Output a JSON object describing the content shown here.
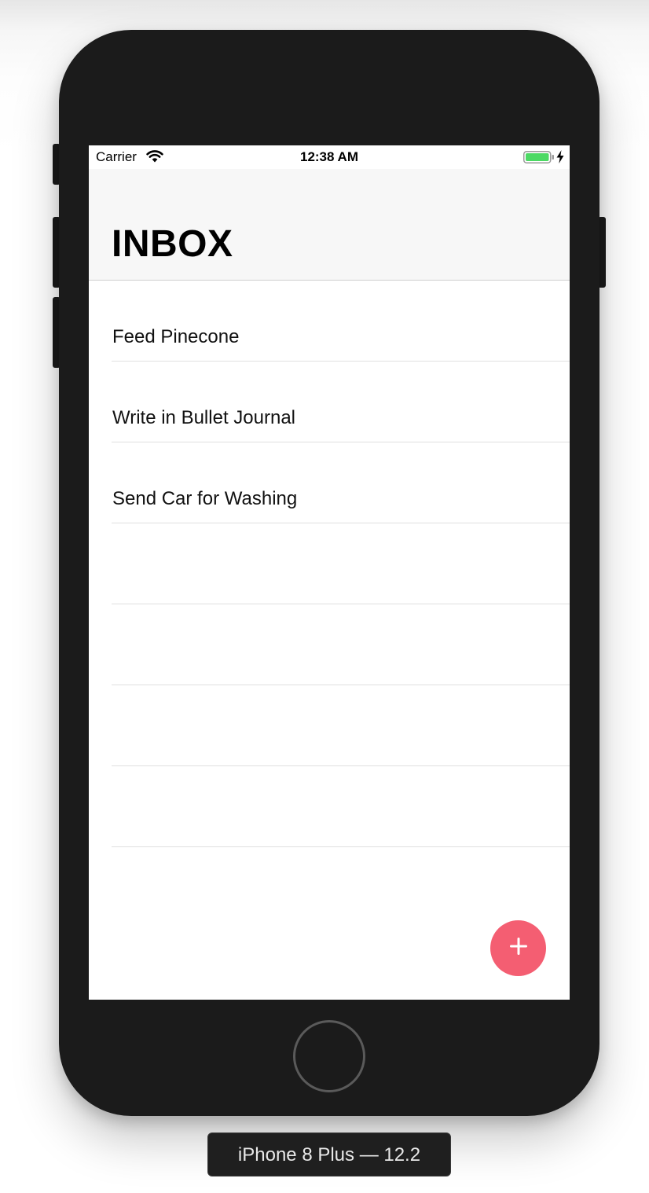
{
  "status_bar": {
    "carrier": "Carrier",
    "time": "12:38 AM",
    "wifi_icon": "wifi-icon",
    "battery_icon": "battery-full-icon",
    "charging_icon": "charging-bolt-icon",
    "battery_level": 1.0
  },
  "header": {
    "title": "INBOX"
  },
  "tasks": [
    {
      "label": "Feed Pinecone"
    },
    {
      "label": "Write in Bullet Journal"
    },
    {
      "label": "Send Car for Washing"
    },
    {
      "label": ""
    },
    {
      "label": ""
    },
    {
      "label": ""
    },
    {
      "label": ""
    }
  ],
  "fab": {
    "icon": "plus-icon",
    "color": "#f45e72"
  },
  "simulator": {
    "device_label": "iPhone 8 Plus — 12.2"
  },
  "colors": {
    "battery_green": "#4cd964",
    "accent": "#f45e72",
    "device_body": "#1b1b1b"
  }
}
